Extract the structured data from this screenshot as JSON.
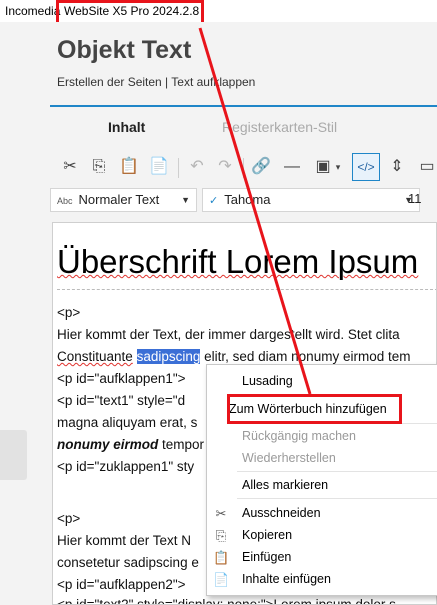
{
  "window": {
    "app_prefix": "Incomedia",
    "title": "WebSite X5 Pro 2024.2.8"
  },
  "header": {
    "title": "Objekt Text",
    "subtitle": "Erstellen der Seiten | Text aufklappen"
  },
  "tabs": [
    {
      "label": "Inhalt"
    },
    {
      "label": "Registerkarten-Stil"
    }
  ],
  "format": {
    "style_icon": "Abc",
    "style": "Normaler Text",
    "font": "Tahoma",
    "size": "11"
  },
  "editor": {
    "heading": "Überschrift Lorem Ipsum",
    "lines": [
      "<p>",
      "Hier kommt der Text, der immer dargestellt wird. Stet clita",
      "Constituante",
      "sadipscing",
      " elitr, sed diam nonumy eirmod tem",
      "<p id=\"aufklappen1\">",
      "<p id=\"text1\" style=\"d",
      "magna aliquyam erat, s",
      "nonumy eirmod",
      " tempor",
      "<p id=\"zuklappen1\" sty",
      "<p>",
      "Hier kommt der Text N",
      "consetetur sadipscing e",
      "<p id=\"aufklappen2\">",
      "<p id=\"text2\" style=\"display: none;\">Lorem ipsum dolor s"
    ]
  },
  "context_menu": {
    "items": [
      {
        "label": "Lusading",
        "enabled": true,
        "icon": ""
      },
      {
        "label": "Zum Wörterbuch hinzufügen",
        "enabled": true,
        "icon": ""
      },
      {
        "label": "Rückgängig machen",
        "enabled": false,
        "icon": ""
      },
      {
        "label": "Wiederherstellen",
        "enabled": false,
        "icon": ""
      },
      {
        "label": "Alles markieren",
        "enabled": true,
        "icon": ""
      },
      {
        "label": "Ausschneiden",
        "enabled": true,
        "icon": "scissors-icon"
      },
      {
        "label": "Kopieren",
        "enabled": true,
        "icon": "copy-icon"
      },
      {
        "label": "Einfügen",
        "enabled": true,
        "icon": "paste-icon"
      },
      {
        "label": "Inhalte einfügen",
        "enabled": true,
        "icon": "paste-special-icon"
      }
    ]
  },
  "colors": {
    "accent": "#1f86c8",
    "annotation": "#e8141b",
    "selection": "#3b6fd6"
  }
}
